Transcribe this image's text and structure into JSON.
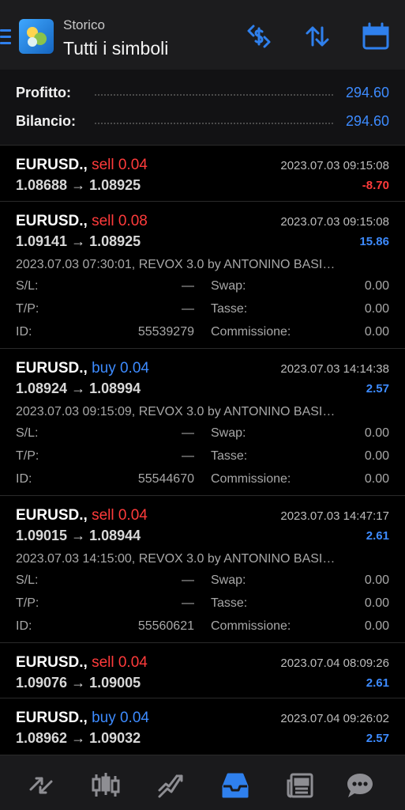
{
  "header": {
    "subtitle": "Storico",
    "title": "Tutti i simboli",
    "accent": "#2f80ed"
  },
  "summary": {
    "profit_label": "Profitto:",
    "profit_value": "294.60",
    "balance_label": "Bilancio:",
    "balance_value": "294.60"
  },
  "details_labels": {
    "sl": "S/L:",
    "tp": "T/P:",
    "id": "ID:",
    "swap": "Swap:",
    "taxes": "Tasse:",
    "commission": "Commissione:"
  },
  "trades": [
    {
      "symbol": "EURUSD.,",
      "side": "sell 0.04",
      "date": "2023.07.03 09:15:08",
      "prices": "1.08688 → 1.08925",
      "profit": "-8.70"
    },
    {
      "symbol": "EURUSD.,",
      "side": "sell 0.08",
      "date": "2023.07.03 09:15:08",
      "prices": "1.09141 → 1.08925",
      "profit": "15.86",
      "comment": "2023.07.03 07:30:01, REVOX 3.0 by ANTONINO BASI…",
      "sl": "—",
      "tp": "—",
      "id": "55539279",
      "swap": "0.00",
      "taxes": "0.00",
      "commission": "0.00"
    },
    {
      "symbol": "EURUSD.,",
      "side": "buy 0.04",
      "date": "2023.07.03 14:14:38",
      "prices": "1.08924 → 1.08994",
      "profit": "2.57",
      "comment": "2023.07.03 09:15:09, REVOX 3.0 by ANTONINO BASI…",
      "sl": "—",
      "tp": "—",
      "id": "55544670",
      "swap": "0.00",
      "taxes": "0.00",
      "commission": "0.00"
    },
    {
      "symbol": "EURUSD.,",
      "side": "sell 0.04",
      "date": "2023.07.03 14:47:17",
      "prices": "1.09015 → 1.08944",
      "profit": "2.61",
      "comment": "2023.07.03 14:15:00, REVOX 3.0 by ANTONINO BASI…",
      "sl": "—",
      "tp": "—",
      "id": "55560621",
      "swap": "0.00",
      "taxes": "0.00",
      "commission": "0.00"
    },
    {
      "symbol": "EURUSD.,",
      "side": "sell 0.04",
      "date": "2023.07.04 08:09:26",
      "prices": "1.09076 → 1.09005",
      "profit": "2.61"
    },
    {
      "symbol": "EURUSD.,",
      "side": "buy 0.04",
      "date": "2023.07.04 09:26:02",
      "prices": "1.08962 → 1.09032",
      "profit": "2.57"
    }
  ],
  "colors": {
    "sell": "#ff3b3b",
    "buy": "#3d8bff",
    "loss": "#ff3b3b",
    "gain": "#3d8bff"
  },
  "bottom_nav": [
    {
      "icon": "quotes-icon"
    },
    {
      "icon": "chart-icon"
    },
    {
      "icon": "trade-icon"
    },
    {
      "icon": "history-icon",
      "active": true
    },
    {
      "icon": "news-icon"
    },
    {
      "icon": "messages-icon"
    }
  ]
}
